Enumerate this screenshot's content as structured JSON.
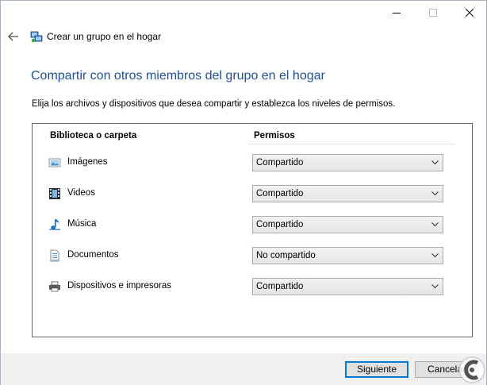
{
  "window": {
    "title": "Crear un grupo en el hogar",
    "heading": "Compartir con otros miembros del grupo en el hogar",
    "instructions": "Elija los archivos y dispositivos que desea compartir y establezca los niveles de permisos."
  },
  "table": {
    "col_library": "Biblioteca o carpeta",
    "col_permissions": "Permisos",
    "rows": [
      {
        "label": "Imágenes",
        "icon": "pictures-icon",
        "value": "Compartido"
      },
      {
        "label": "Videos",
        "icon": "videos-icon",
        "value": "Compartido"
      },
      {
        "label": "Música",
        "icon": "music-icon",
        "value": "Compartido"
      },
      {
        "label": "Documentos",
        "icon": "documents-icon",
        "value": "No compartido"
      },
      {
        "label": "Dispositivos e impresoras",
        "icon": "printer-icon",
        "value": "Compartido"
      }
    ]
  },
  "footer": {
    "next_label": "Siguiente",
    "cancel_label": "Cancelar"
  },
  "colors": {
    "heading": "#1f4f9a",
    "focus_border": "#0078d7"
  }
}
